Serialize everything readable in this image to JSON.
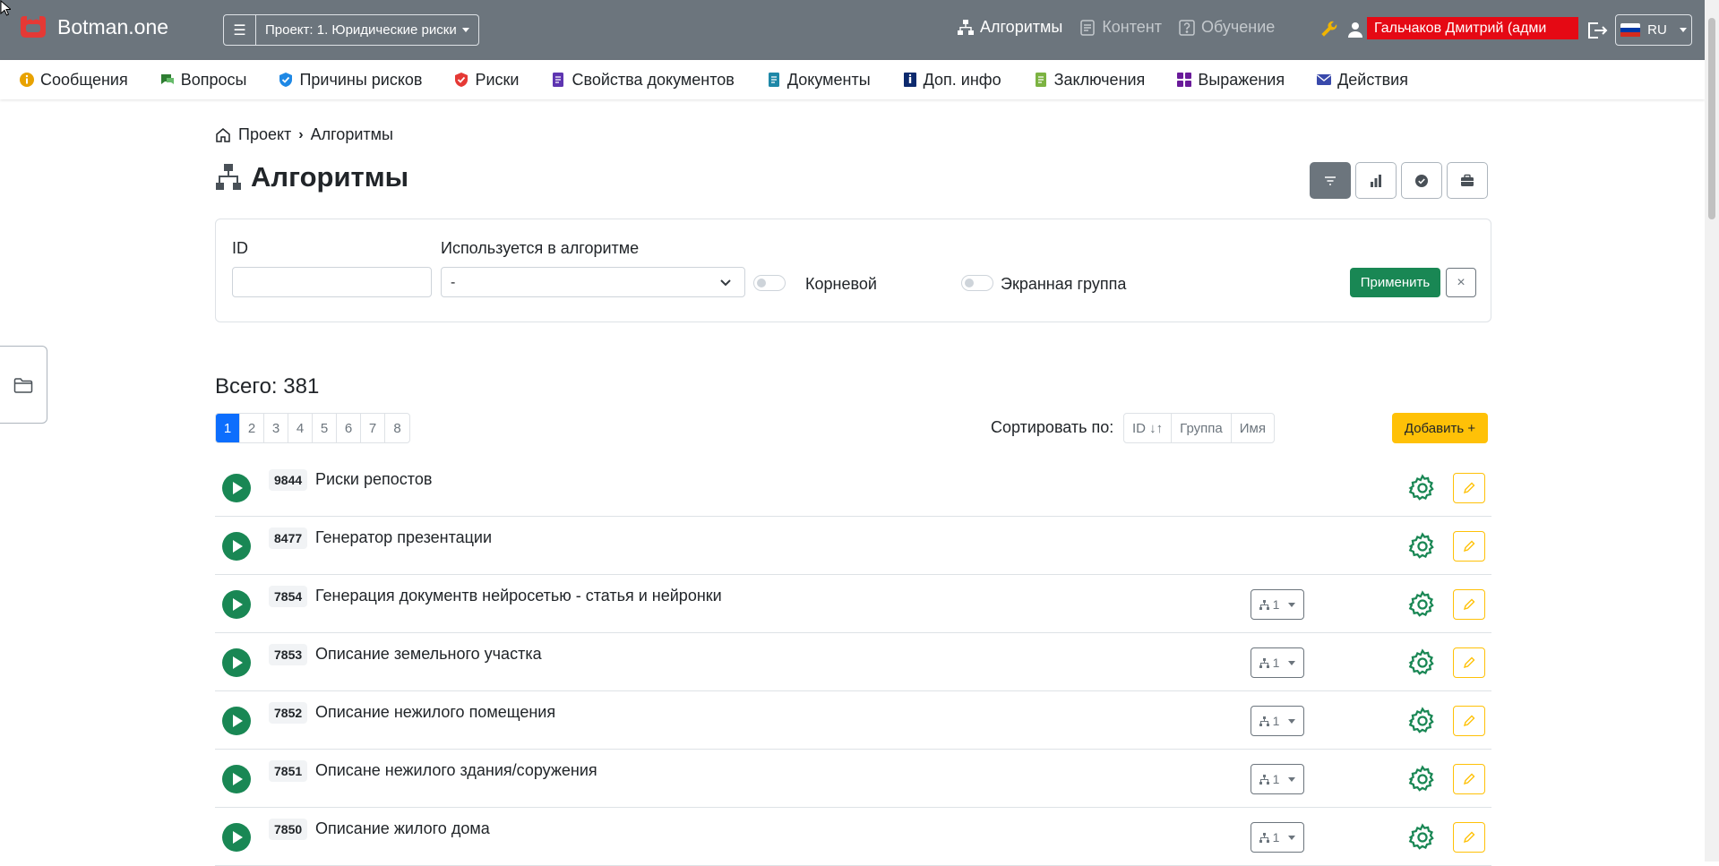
{
  "header": {
    "brand": "Botman.one",
    "project_label": "Проект: 1. Юридические риски",
    "nav": [
      {
        "label": "Алгоритмы",
        "active": true
      },
      {
        "label": "Контент",
        "active": false
      },
      {
        "label": "Обучение",
        "active": false
      }
    ],
    "user_name": "Гальчаков Дмитрий (адми",
    "language": "RU"
  },
  "menu": [
    {
      "label": "Сообщения",
      "icon": "info-circle-icon",
      "color": "#e8a200"
    },
    {
      "label": "Вопросы",
      "icon": "question-chat-icon",
      "color": "#2e7d32"
    },
    {
      "label": "Причины рисков",
      "icon": "shield-check-icon",
      "color": "#1e88e5"
    },
    {
      "label": "Риски",
      "icon": "shield-icon",
      "color": "#e53935"
    },
    {
      "label": "Свойства документов",
      "icon": "document-icon",
      "color": "#5e35b1"
    },
    {
      "label": "Документы",
      "icon": "document-icon",
      "color": "#1e88a8"
    },
    {
      "label": "Доп. инфо",
      "icon": "info-book-icon",
      "color": "#0d2a6e"
    },
    {
      "label": "Заключения",
      "icon": "document-icon",
      "color": "#7cb342"
    },
    {
      "label": "Выражения",
      "icon": "grid-icon",
      "color": "#6a1b9a"
    },
    {
      "label": "Действия",
      "icon": "envelope-icon",
      "color": "#3949ab"
    }
  ],
  "breadcrumb": {
    "root": "Проект",
    "current": "Алгоритмы"
  },
  "page_title": "Алгоритмы",
  "filter": {
    "id_label": "ID",
    "id_value": "",
    "used_in_label": "Используется в алгоритме",
    "used_in_value": "-",
    "root_toggle_label": "Корневой",
    "screen_group_toggle_label": "Экранная группа",
    "apply_label": "Применить",
    "clear_label": "×"
  },
  "total": "Всего: 381",
  "pagination": [
    "1",
    "2",
    "3",
    "4",
    "5",
    "6",
    "7",
    "8"
  ],
  "current_page": "1",
  "sort": {
    "label": "Сортировать по:",
    "options": [
      "ID ↓↑",
      "Группа",
      "Имя"
    ]
  },
  "add_label": "Добавить +",
  "algorithms": [
    {
      "id": "9844",
      "name": "Риски репостов",
      "used_by": ""
    },
    {
      "id": "8477",
      "name": "Генератор презентации",
      "used_by": ""
    },
    {
      "id": "7854",
      "name": "Генерация документв нейросетью - статья и нейронки",
      "used_by": "1"
    },
    {
      "id": "7853",
      "name": "Описание земельного участка",
      "used_by": "1"
    },
    {
      "id": "7852",
      "name": "Описание нежилого помещения",
      "used_by": "1"
    },
    {
      "id": "7851",
      "name": "Описане нежилого здания/соружения",
      "used_by": "1"
    },
    {
      "id": "7850",
      "name": "Описание жилого дома",
      "used_by": "1"
    }
  ],
  "colors": {
    "navbar": "#6c757d",
    "success": "#198754",
    "warning": "#ffc107",
    "primary": "#0d6efd",
    "redaction": "#e50914"
  }
}
